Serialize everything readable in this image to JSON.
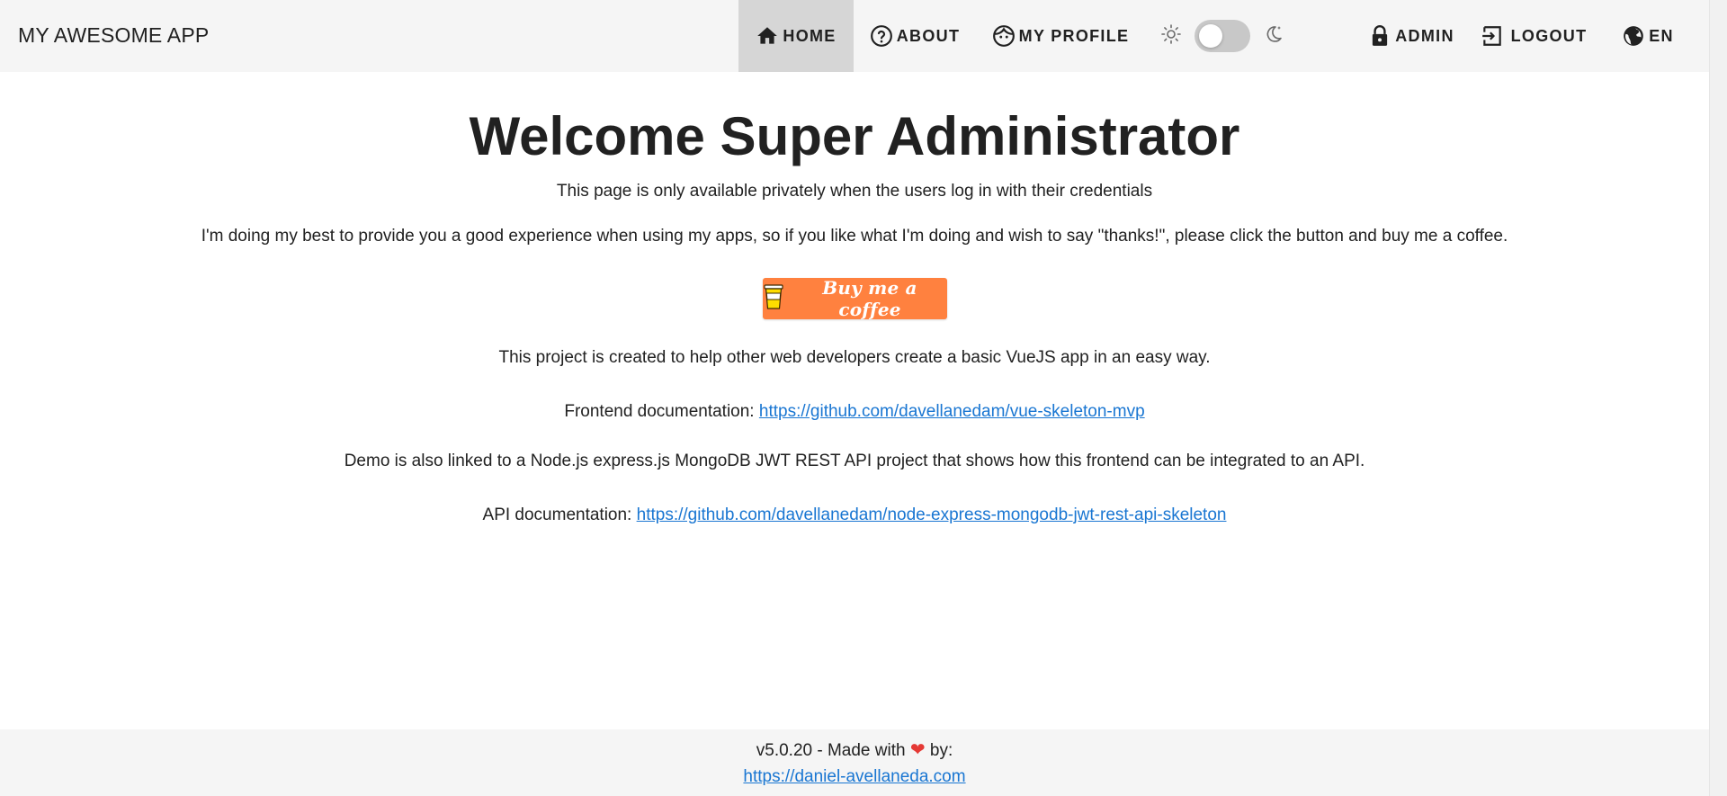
{
  "header": {
    "app_title": "MY AWESOME APP",
    "nav": {
      "home": "HOME",
      "about": "ABOUT",
      "profile": "MY PROFILE",
      "admin": "ADMIN",
      "logout": "LOGOUT",
      "language": "EN"
    },
    "theme_switch_on": false
  },
  "main": {
    "title": "Welcome Super Administrator",
    "private_notice": "This page is only available privately when the users log in with their credentials",
    "coffee_text": "I'm doing my best to provide you a good experience when using my apps, so if you like what I'm doing and wish to say \"thanks!\", please click the button and buy me a coffee.",
    "coffee_button": "Buy me a coffee",
    "project_text": "This project is created to help other web developers create a basic VueJS app in an easy way.",
    "frontend_label": "Frontend documentation: ",
    "frontend_link": "https://github.com/davellanedam/vue-skeleton-mvp",
    "demo_text": "Demo is also linked to a Node.js express.js MongoDB JWT REST API project that shows how this frontend can be integrated to an API.",
    "api_label": "API documentation: ",
    "api_link": "https://github.com/davellanedam/node-express-mongodb-jwt-rest-api-skeleton"
  },
  "footer": {
    "version_prefix": "v5.0.20 - Made with ",
    "version_suffix": " by:",
    "author_link": "https://daniel-avellaneda.com"
  },
  "colors": {
    "topbar_bg": "#f5f5f5",
    "active_nav_bg": "#d6d6d6",
    "link": "#1976d2",
    "coffee_button": "#ff813f",
    "heart": "#e53935"
  },
  "icons": {
    "home": "home-icon",
    "about": "help-circle-icon",
    "profile": "face-icon",
    "light": "sun-icon",
    "dark": "moon-stars-icon",
    "admin": "lock-icon",
    "logout": "logout-icon",
    "language": "globe-icon",
    "coffee": "coffee-cup-icon",
    "heart": "heart-icon"
  }
}
